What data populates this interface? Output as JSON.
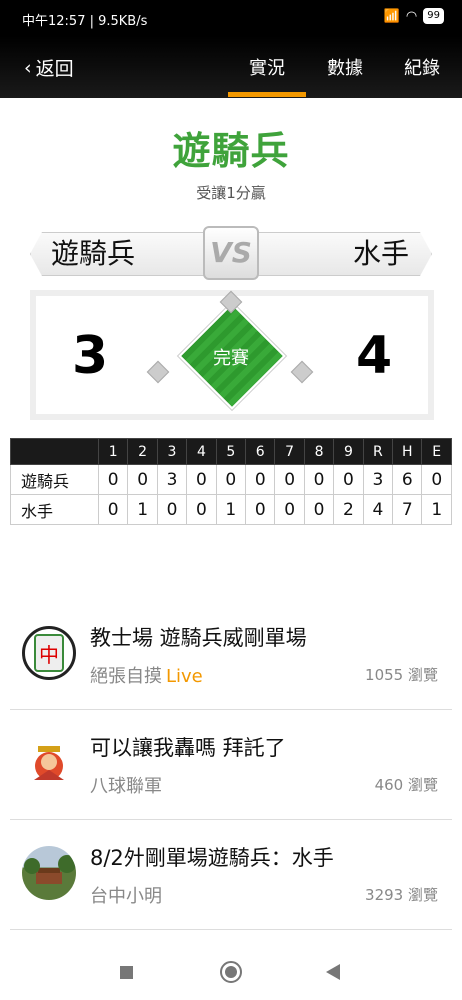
{
  "status_bar": {
    "time_speed": "中午12:57 | 9.5KB/s",
    "battery": "99"
  },
  "nav": {
    "back_label": "返回",
    "tabs": [
      "實況",
      "數據",
      "紀錄"
    ]
  },
  "header": {
    "winner": "遊騎兵",
    "subtitle": "受讓1分贏"
  },
  "matchup": {
    "away_team": "遊騎兵",
    "home_team": "水手",
    "vs_label": "VS",
    "away_score": "3",
    "home_score": "4",
    "game_status": "完賽"
  },
  "linescore": {
    "columns": [
      "",
      "1",
      "2",
      "3",
      "4",
      "5",
      "6",
      "7",
      "8",
      "9",
      "R",
      "H",
      "E"
    ],
    "rows": [
      [
        "遊騎兵",
        "0",
        "0",
        "3",
        "0",
        "0",
        "0",
        "0",
        "0",
        "0",
        "3",
        "6",
        "0"
      ],
      [
        "水手",
        "0",
        "1",
        "0",
        "0",
        "1",
        "0",
        "0",
        "0",
        "2",
        "4",
        "7",
        "1"
      ]
    ]
  },
  "posts": [
    {
      "title": "教士場 遊騎兵威剛單場",
      "author": "絕張自摸",
      "badge": "Live",
      "views": "1055 瀏覽"
    },
    {
      "title": "可以讓我轟嗎 拜託了",
      "author": "八球聯軍",
      "badge": "",
      "views": "460 瀏覽"
    },
    {
      "title": "8/2㚈剛單場遊騎兵：水手",
      "author": "台中小明",
      "badge": "",
      "views": "3293 瀏覽"
    }
  ],
  "colors": {
    "accent": "#f39800",
    "title_green": "#3fa33b"
  }
}
